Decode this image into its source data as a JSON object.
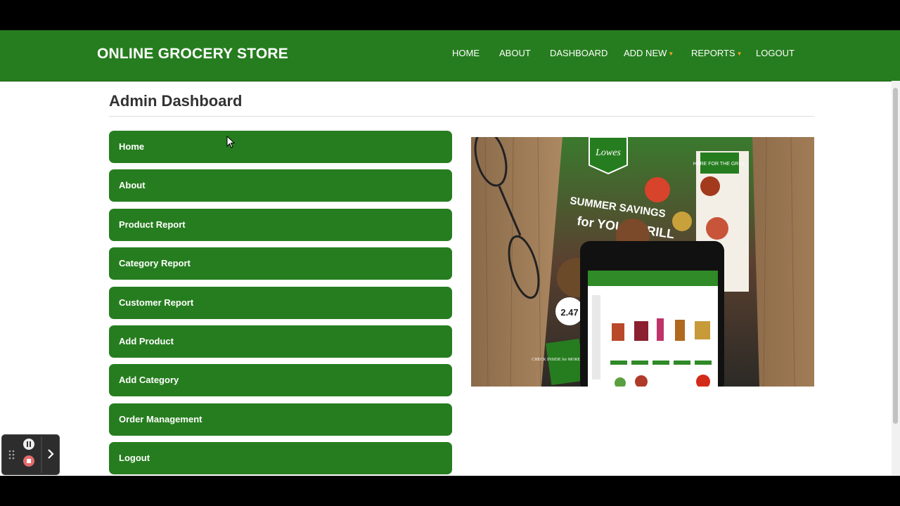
{
  "navbar": {
    "brand": "ONLINE GROCERY STORE",
    "items": [
      {
        "label": "HOME",
        "dropdown": false
      },
      {
        "label": "ABOUT",
        "dropdown": false
      },
      {
        "label": "DASHBOARD",
        "dropdown": false
      },
      {
        "label": "ADD NEW",
        "dropdown": true
      },
      {
        "label": "REPORTS",
        "dropdown": true
      },
      {
        "label": "LOGOUT",
        "dropdown": false
      }
    ]
  },
  "page": {
    "title": "Admin Dashboard"
  },
  "menu": [
    "Home",
    "About",
    "Product Report",
    "Category Report",
    "Customer Report",
    "Add Product",
    "Add Category",
    "Order Management",
    "Logout"
  ],
  "hero": {
    "logo_text": "Lowes",
    "headline_1": "SUMMER SAVINGS",
    "headline_2": "for YOUR GRILL",
    "badge": "CHECK INSIDE for MORE SAVINGS",
    "side_tag": "HERE FOR THE GRILL",
    "price": "2.47"
  },
  "colors": {
    "primary": "#267d1f",
    "caret": "#f6a21c",
    "background": "#ffffff"
  },
  "icons": {
    "recorder": [
      "drag-handle-icon",
      "pause-icon",
      "stop-icon",
      "chevron-right-icon"
    ]
  }
}
